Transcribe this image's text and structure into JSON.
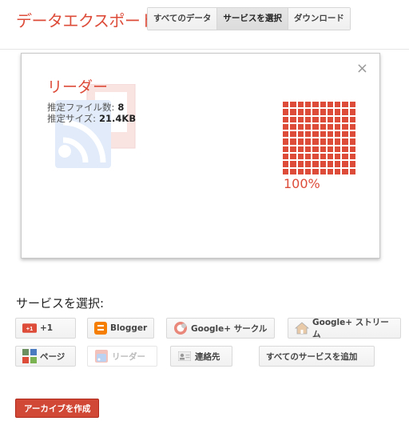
{
  "header": {
    "title": "データエクスポート",
    "tabs": [
      "すべてのデータ",
      "サービスを選択",
      "ダウンロード"
    ],
    "active_tab": 1
  },
  "progress_card": {
    "service_name": "リーダー",
    "file_count_label": "推定ファイル数:",
    "file_count": "8",
    "size_label": "推定サイズ:",
    "size": "21.4KB",
    "progress_percent": "100%",
    "progress_fraction": 1.0,
    "close_icon": "close-icon"
  },
  "services": {
    "heading": "サービスを選択:",
    "items": [
      {
        "label": "+1",
        "icon": "plus-one-icon",
        "enabled": true
      },
      {
        "label": "Blogger",
        "icon": "blogger-icon",
        "enabled": true
      },
      {
        "label": "Google+ サークル",
        "icon": "circles-icon",
        "enabled": true
      },
      {
        "label": "Google+ ストリーム",
        "icon": "home-icon",
        "enabled": true
      },
      {
        "label": "ページ",
        "icon": "pages-icon",
        "enabled": true
      },
      {
        "label": "リーダー",
        "icon": "reader-icon",
        "enabled": false
      },
      {
        "label": "連絡先",
        "icon": "contacts-icon",
        "enabled": true
      },
      {
        "label": "すべてのサービスを追加",
        "icon": "",
        "enabled": true
      }
    ]
  },
  "actions": {
    "create_archive": "アーカイブを作成"
  },
  "colors": {
    "accent": "#dd4b39",
    "create_button": "#d14836"
  }
}
